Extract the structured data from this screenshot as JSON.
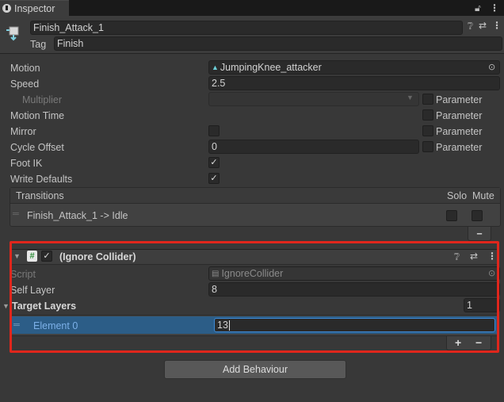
{
  "tab": {
    "title": "Inspector"
  },
  "header": {
    "state_name": "Finish_Attack_1",
    "tag_label": "Tag",
    "tag_value": "Finish"
  },
  "props": {
    "motion_label": "Motion",
    "motion_value": "JumpingKnee_attacker",
    "speed_label": "Speed",
    "speed_value": "2.5",
    "multiplier_label": "Multiplier",
    "motion_time_label": "Motion Time",
    "mirror_label": "Mirror",
    "cycle_offset_label": "Cycle Offset",
    "cycle_offset_value": "0",
    "foot_ik_label": "Foot IK",
    "write_defaults_label": "Write Defaults",
    "parameter_label": "Parameter"
  },
  "transitions": {
    "title": "Transitions",
    "solo_label": "Solo",
    "mute_label": "Mute",
    "items": [
      "Finish_Attack_1 -> Idle"
    ],
    "remove_label": "−"
  },
  "behaviour": {
    "title": "(Ignore Collider)",
    "script_label": "Script",
    "script_value": "IgnoreCollider",
    "self_layer_label": "Self Layer",
    "self_layer_value": "8",
    "target_layers_label": "Target Layers",
    "target_layers_size": "1",
    "element_label": "Element 0",
    "element_value": "13",
    "add_label": "+",
    "remove_label": "−"
  },
  "footer": {
    "add_behaviour_label": "Add Behaviour"
  },
  "icons": [
    "info-icon",
    "lock-icon",
    "more-icon",
    "state-icon",
    "help-icon",
    "presets-icon",
    "object-picker-icon",
    "script-icon",
    "drag-handle-icon",
    "dropdown-arrow-icon",
    "checkmark-icon",
    "foldout-arrow-icon"
  ]
}
